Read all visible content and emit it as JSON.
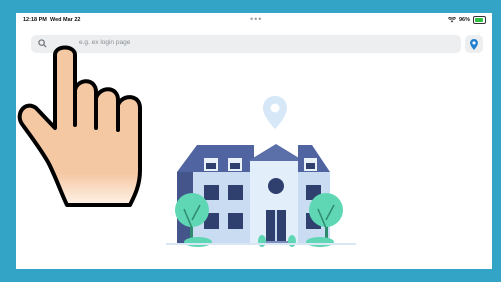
{
  "statusbar": {
    "time": "12:18 PM",
    "date": "Wed Mar 22",
    "battery_text": "96%"
  },
  "search": {
    "placeholder": "e.g. ex login page"
  },
  "icons": {
    "search": "search-icon",
    "location_pin": "location-pin-icon",
    "map_pin": "map-pin-icon",
    "wifi": "wifi-icon",
    "battery": "battery-icon",
    "multitask_dots": "more-dots-icon",
    "pointing_hand": "pointing-hand-icon"
  },
  "colors": {
    "frame": "#33a3c6",
    "accent": "#1f7fd1",
    "building_roof": "#5b6fa8",
    "building_wall": "#c9dcf2",
    "tree": "#5fd6b4"
  }
}
